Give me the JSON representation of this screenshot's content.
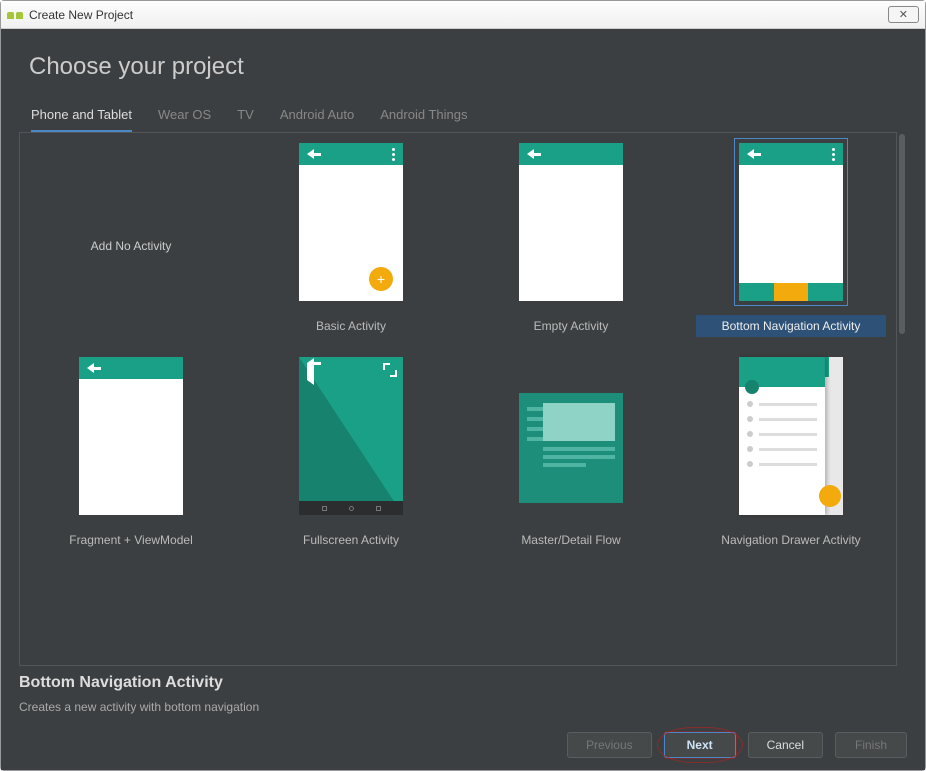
{
  "window": {
    "title": "Create New Project"
  },
  "page": {
    "title": "Choose your project"
  },
  "tabs": [
    {
      "label": "Phone and Tablet",
      "active": true
    },
    {
      "label": "Wear OS"
    },
    {
      "label": "TV"
    },
    {
      "label": "Android Auto"
    },
    {
      "label": "Android Things"
    }
  ],
  "templates": [
    {
      "label": "Add No Activity"
    },
    {
      "label": "Basic Activity"
    },
    {
      "label": "Empty Activity"
    },
    {
      "label": "Bottom Navigation Activity",
      "selected": true
    },
    {
      "label": "Fragment + ViewModel"
    },
    {
      "label": "Fullscreen Activity"
    },
    {
      "label": "Master/Detail Flow"
    },
    {
      "label": "Navigation Drawer Activity"
    }
  ],
  "selection": {
    "title": "Bottom Navigation Activity",
    "description": "Creates a new activity with bottom navigation"
  },
  "buttons": {
    "previous": "Previous",
    "next": "Next",
    "cancel": "Cancel",
    "finish": "Finish"
  }
}
